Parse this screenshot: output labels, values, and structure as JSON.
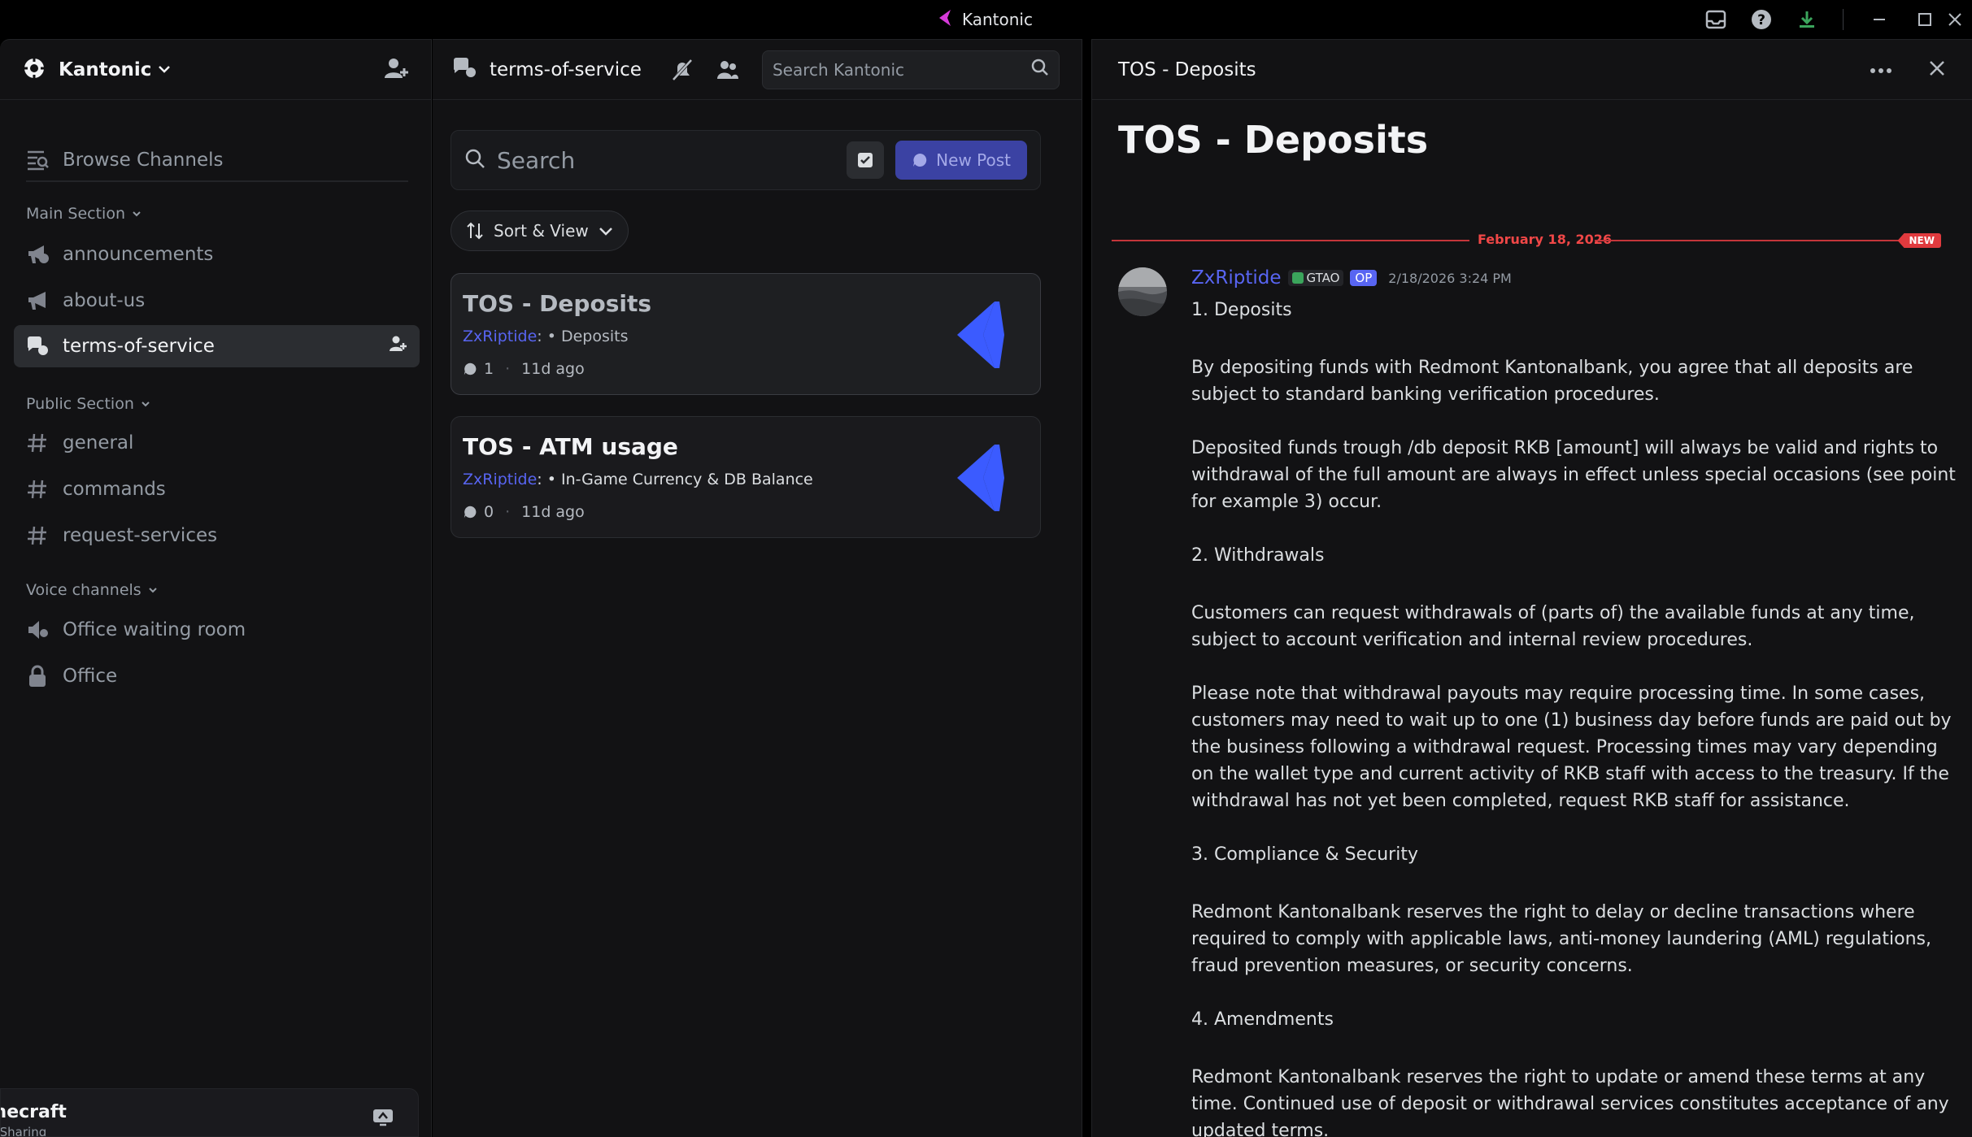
{
  "titlebar": {
    "app_title": "Kantonic",
    "icons": [
      "inbox-icon",
      "help-icon",
      "download-icon",
      "minimize-icon",
      "maximize-icon",
      "close-icon"
    ]
  },
  "sidebar": {
    "server_name": "Kantonic",
    "browse_channels": "Browse Channels",
    "sections": {
      "main": "Main Section",
      "public": "Public Section",
      "voice": "Voice channels"
    },
    "channels": {
      "announcements": "announcements",
      "about_us": "about-us",
      "terms": "terms-of-service",
      "general": "general",
      "commands": "commands",
      "request_services": "request-services",
      "office_waiting": "Office waiting room",
      "office": "Office"
    },
    "userbar": {
      "activity": "inecraft",
      "sub": "t Sharing"
    }
  },
  "forum": {
    "channel_name": "terms-of-service",
    "search_placeholder": "Search Kantonic",
    "post_search_placeholder": "Search",
    "new_post": "New Post",
    "sort_view": "Sort & View",
    "posts": [
      {
        "title": "TOS - Deposits",
        "author": "ZxRiptide",
        "tag": ": • Deposits",
        "replies": "1",
        "age": "11d ago"
      },
      {
        "title": "TOS - ATM usage",
        "author": "ZxRiptide",
        "tag": ": • In-Game Currency & DB Balance",
        "replies": "0",
        "age": "11d ago"
      }
    ]
  },
  "thread": {
    "header_title": "TOS - Deposits",
    "title": "TOS - Deposits",
    "date_divider": "February 18, 2026",
    "new_badge": "NEW",
    "author": "ZxRiptide",
    "guild_tag": "GTAO",
    "op_badge": "OP",
    "timestamp": "2/18/2026 3:24 PM",
    "body": [
      "1. Deposits",
      "By depositing funds with Redmont Kantonalbank, you agree that all deposits are subject to standard banking verification procedures.",
      "Deposited funds trough /db deposit RKB [amount] will always be valid and rights to withdrawal of the full amount are always in effect unless special occasions (see point for example 3) occur.",
      "2. Withdrawals",
      "Customers can request withdrawals of (parts of) the available funds at any time, subject to account verification and internal review procedures.",
      "Please note that withdrawal payouts may require processing time. In some cases, customers may need to wait up to one (1) business day before funds are paid out by the business following a withdrawal request. Processing times may vary depending on the wallet type and current activity of RKB staff with access to the treasury. If the withdrawal has not yet been completed, request RKB staff for assistance.",
      "3. Compliance & Security",
      "Redmont Kantonalbank reserves the right to delay or decline transactions where required to comply with applicable laws, anti-money laundering (AML) regulations, fraud prevention measures, or security concerns.",
      "4. Amendments",
      "Redmont Kantonalbank reserves the right to update or amend these terms at any time. Continued use of deposit or withdrawal services constitutes acceptance of any updated terms."
    ]
  },
  "colors": {
    "accent": "#5865f2",
    "new_red": "#e03a3e",
    "logo_blue": "#3b5bff",
    "background": "#121214"
  }
}
